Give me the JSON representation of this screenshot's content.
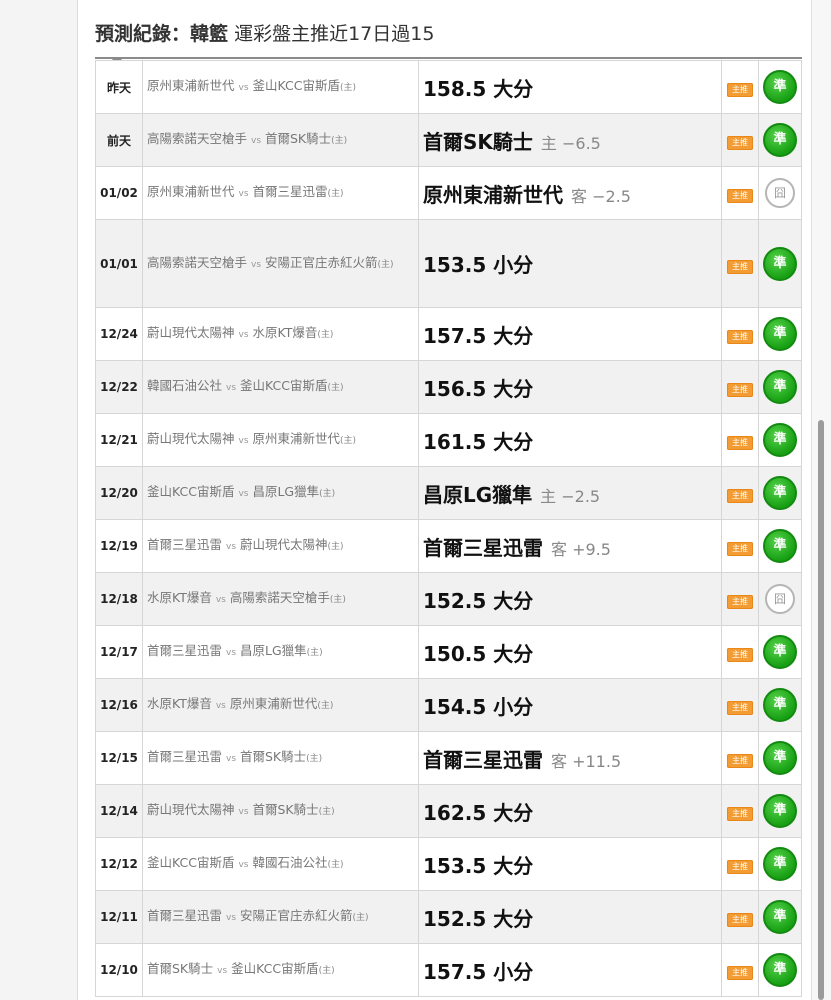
{
  "header": {
    "title_bold": "預測紀錄：韓籃",
    "title_rest": "運彩盤主推近17日過15"
  },
  "records": [
    {
      "date": "昨天",
      "away": "原州東浦新世代",
      "vs": "vs",
      "home": "釜山KCC宙斯盾",
      "home_mark": "(主)",
      "pick": "158.5 大分",
      "odds": "",
      "tag": "主推",
      "result": "準",
      "result_type": "hit"
    },
    {
      "date": "前天",
      "away": "高陽索諾天空槍手",
      "vs": "vs",
      "home": "首爾SK騎士",
      "home_mark": "(主)",
      "pick": "首爾SK騎士",
      "odds": "主 −6.5",
      "tag": "主推",
      "result": "準",
      "result_type": "hit"
    },
    {
      "date": "01/02",
      "away": "原州東浦新世代",
      "vs": "vs",
      "home": "首爾三星迅雷",
      "home_mark": "(主)",
      "pick": "原州東浦新世代",
      "odds": "客 −2.5",
      "tag": "主推",
      "result": "囧",
      "result_type": "push"
    },
    {
      "date": "01/01",
      "away": "高陽索諾天空槍手",
      "vs": "vs",
      "home": "安陽正官庄赤紅火箭",
      "home_mark": "(主)",
      "pick": "153.5 小分",
      "odds": "",
      "tag": "主推",
      "result": "準",
      "result_type": "hit"
    },
    {
      "date": "12/24",
      "away": "蔚山現代太陽神",
      "vs": "vs",
      "home": "水原KT爆音",
      "home_mark": "(主)",
      "pick": "157.5 大分",
      "odds": "",
      "tag": "主推",
      "result": "準",
      "result_type": "hit"
    },
    {
      "date": "12/22",
      "away": "韓國石油公社",
      "vs": "vs",
      "home": "釜山KCC宙斯盾",
      "home_mark": "(主)",
      "pick": "156.5 大分",
      "odds": "",
      "tag": "主推",
      "result": "準",
      "result_type": "hit"
    },
    {
      "date": "12/21",
      "away": "蔚山現代太陽神",
      "vs": "vs",
      "home": "原州東浦新世代",
      "home_mark": "(主)",
      "pick": "161.5 大分",
      "odds": "",
      "tag": "主推",
      "result": "準",
      "result_type": "hit"
    },
    {
      "date": "12/20",
      "away": "釜山KCC宙斯盾",
      "vs": "vs",
      "home": "昌原LG獵隼",
      "home_mark": "(主)",
      "pick": "昌原LG獵隼",
      "odds": "主 −2.5",
      "tag": "主推",
      "result": "準",
      "result_type": "hit"
    },
    {
      "date": "12/19",
      "away": "首爾三星迅雷",
      "vs": "vs",
      "home": "蔚山現代太陽神",
      "home_mark": "(主)",
      "pick": "首爾三星迅雷",
      "odds": "客 +9.5",
      "tag": "主推",
      "result": "準",
      "result_type": "hit"
    },
    {
      "date": "12/18",
      "away": "水原KT爆音",
      "vs": "vs",
      "home": "高陽索諾天空槍手",
      "home_mark": "(主)",
      "pick": "152.5 大分",
      "odds": "",
      "tag": "主推",
      "result": "囧",
      "result_type": "push"
    },
    {
      "date": "12/17",
      "away": "首爾三星迅雷",
      "vs": "vs",
      "home": "昌原LG獵隼",
      "home_mark": "(主)",
      "pick": "150.5 大分",
      "odds": "",
      "tag": "主推",
      "result": "準",
      "result_type": "hit"
    },
    {
      "date": "12/16",
      "away": "水原KT爆音",
      "vs": "vs",
      "home": "原州東浦新世代",
      "home_mark": "(主)",
      "pick": "154.5 小分",
      "odds": "",
      "tag": "主推",
      "result": "準",
      "result_type": "hit"
    },
    {
      "date": "12/15",
      "away": "首爾三星迅雷",
      "vs": "vs",
      "home": "首爾SK騎士",
      "home_mark": "(主)",
      "pick": "首爾三星迅雷",
      "odds": "客 +11.5",
      "tag": "主推",
      "result": "準",
      "result_type": "hit"
    },
    {
      "date": "12/14",
      "away": "蔚山現代太陽神",
      "vs": "vs",
      "home": "首爾SK騎士",
      "home_mark": "(主)",
      "pick": "162.5 大分",
      "odds": "",
      "tag": "主推",
      "result": "準",
      "result_type": "hit"
    },
    {
      "date": "12/12",
      "away": "釜山KCC宙斯盾",
      "vs": "vs",
      "home": "韓國石油公社",
      "home_mark": "(主)",
      "pick": "153.5 大分",
      "odds": "",
      "tag": "主推",
      "result": "準",
      "result_type": "hit"
    },
    {
      "date": "12/11",
      "away": "首爾三星迅雷",
      "vs": "vs",
      "home": "安陽正官庄赤紅火箭",
      "home_mark": "(主)",
      "pick": "152.5 大分",
      "odds": "",
      "tag": "主推",
      "result": "準",
      "result_type": "hit"
    },
    {
      "date": "12/10",
      "away": "首爾SK騎士",
      "vs": "vs",
      "home": "釜山KCC宙斯盾",
      "home_mark": "(主)",
      "pick": "157.5 小分",
      "odds": "",
      "tag": "主推",
      "result": "準",
      "result_type": "hit"
    }
  ]
}
